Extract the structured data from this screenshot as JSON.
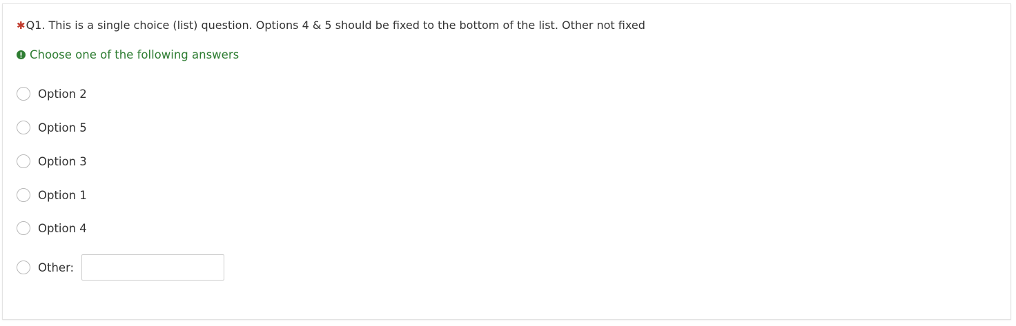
{
  "question": {
    "required_marker": "✱",
    "text": "Q1. This is a single choice (list) question. Options 4 & 5 should be fixed to the bottom of the list. Other not fixed",
    "help_icon": "exclamation-circle-icon",
    "help_text": "Choose one of the following answers"
  },
  "answers": [
    {
      "label": "Option 2",
      "checked": false
    },
    {
      "label": "Option 5",
      "checked": false
    },
    {
      "label": "Option 3",
      "checked": false
    },
    {
      "label": "Option 1",
      "checked": false
    },
    {
      "label": "Option 4",
      "checked": false
    }
  ],
  "other": {
    "label": "Other:",
    "value": "",
    "placeholder": "",
    "checked": false
  },
  "colors": {
    "required_marker": "#c0392b",
    "help_text": "#2e7d32",
    "text": "#333333"
  }
}
